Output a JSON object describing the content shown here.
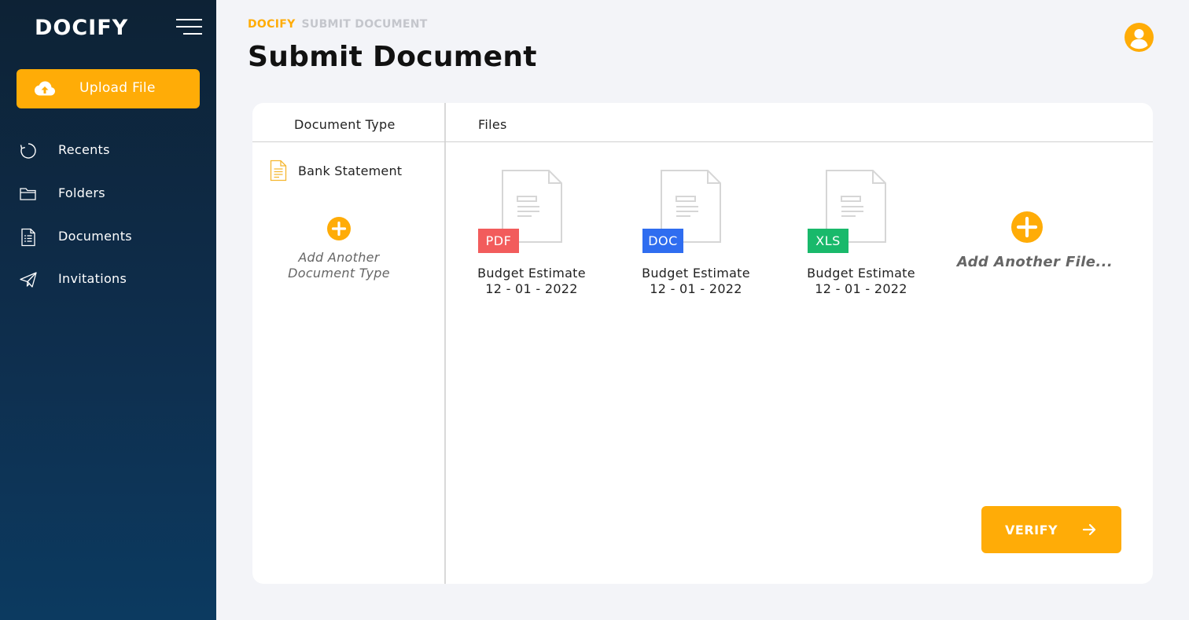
{
  "app": {
    "logo": "DOCIFY"
  },
  "sidebar": {
    "upload_label": "Upload File",
    "items": [
      {
        "label": "Recents",
        "icon": "refresh-icon"
      },
      {
        "label": "Folders",
        "icon": "folder-icon"
      },
      {
        "label": "Documents",
        "icon": "document-list-icon"
      },
      {
        "label": "Invitations",
        "icon": "paper-plane-icon"
      }
    ]
  },
  "header": {
    "breadcrumb": [
      "DOCIFY",
      "SUBMIT DOCUMENT"
    ],
    "title": "Submit Document"
  },
  "card": {
    "doc_type_header": "Document Type",
    "files_header": "Files",
    "doc_types": [
      {
        "label": "Bank Statement"
      }
    ],
    "add_doc_type_label_line1": "Add Another",
    "add_doc_type_label_line2": "Document Type",
    "files": [
      {
        "type": "PDF",
        "name": "Budget Estimate",
        "date": "12 - 01 - 2022",
        "color": "#f25c5c"
      },
      {
        "type": "DOC",
        "name": "Budget Estimate",
        "date": "12 - 01 - 2022",
        "color": "#2f6df0"
      },
      {
        "type": "XLS",
        "name": "Budget Estimate",
        "date": "12 - 01 - 2022",
        "color": "#19b96b"
      }
    ],
    "add_file_label": "Add Another File...",
    "verify_label": "VERIFY"
  },
  "colors": {
    "accent": "#ffac07",
    "sidebar_top": "#0d2235",
    "sidebar_bottom": "#0c3a60"
  }
}
